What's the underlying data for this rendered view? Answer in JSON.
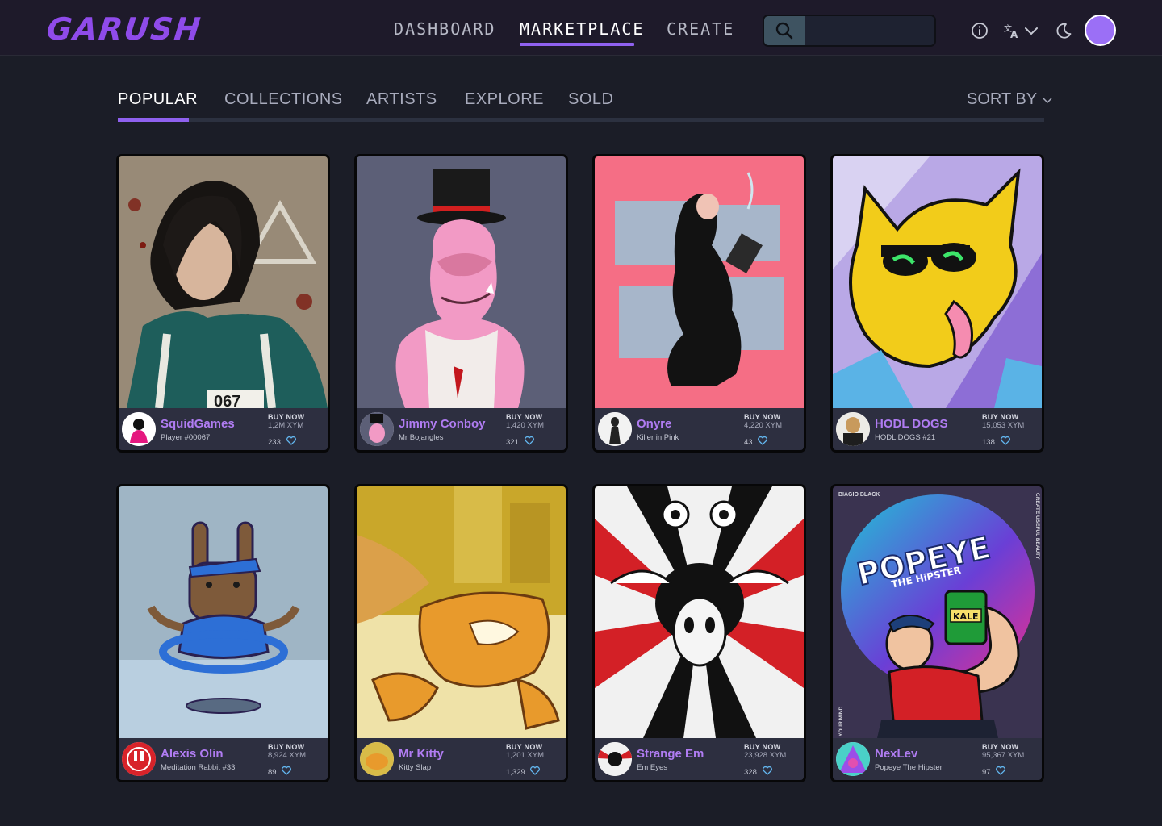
{
  "header": {
    "logo": "GARUSH",
    "nav": [
      {
        "label": "DASHBOARD"
      },
      {
        "label": "MARKETPLACE"
      },
      {
        "label": "CREATE"
      }
    ],
    "search_placeholder": "",
    "icons": [
      "search-icon",
      "info-icon",
      "translate-icon",
      "chevron-down-icon",
      "moon-icon"
    ],
    "accent": "#8f61ef"
  },
  "tabs": [
    {
      "label": "POPULAR"
    },
    {
      "label": "COLLECTIONS"
    },
    {
      "label": "ARTISTS"
    },
    {
      "label": "EXPLORE"
    },
    {
      "label": "SOLD"
    }
  ],
  "sort_label": "SORT BY",
  "cards": [
    {
      "name": "SquidGames",
      "sub": "Player #00067",
      "buy": "BUY NOW",
      "price": "1,2M XYM",
      "likes": "233"
    },
    {
      "name": "Jimmy Conboy",
      "sub": "Mr Bojangles",
      "buy": "BUY NOW",
      "price": "1,420 XYM",
      "likes": "321"
    },
    {
      "name": "Onyre",
      "sub": "Killer in Pink",
      "buy": "BUY NOW",
      "price": "4,220 XYM",
      "likes": "43"
    },
    {
      "name": "HODL DOGS",
      "sub": "HODL DOGS #21",
      "buy": "BUY NOW",
      "price": "15,053 XYM",
      "likes": "138"
    },
    {
      "name": "Alexis Olin",
      "sub": "Meditation Rabbit #33",
      "buy": "BUY NOW",
      "price": "8,924 XYM",
      "likes": "89"
    },
    {
      "name": "Mr Kitty",
      "sub": "Kitty Slap",
      "buy": "BUY NOW",
      "price": "1,201 XYM",
      "likes": "1,329"
    },
    {
      "name": "Strange Em",
      "sub": "Em Eyes",
      "buy": "BUY NOW",
      "price": "23,928 XYM",
      "likes": "328"
    },
    {
      "name": "NexLev",
      "sub": "Popeye The Hipster",
      "buy": "BUY NOW",
      "price": "95,367 XYM",
      "likes": "97"
    }
  ],
  "art_text": {
    "squid_number": "067",
    "popeye_top": "BIAGIO BLACK",
    "popeye_side": "CREATE USEFUL BEAUTY",
    "popeye_side2": "YOUR MIND",
    "popeye_title": "POPEYE",
    "popeye_subtitle": "THE HiPSTER",
    "popeye_can": "KALE"
  }
}
